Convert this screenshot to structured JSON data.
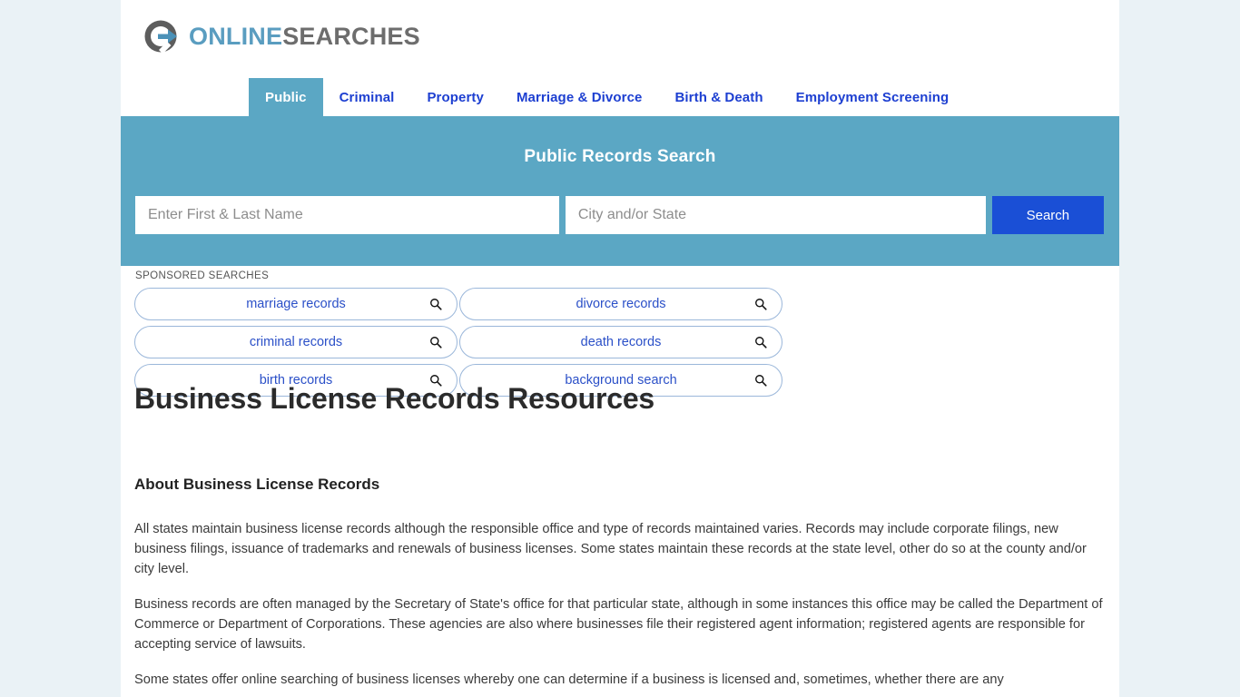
{
  "site": {
    "logo_primary": "ONLINE",
    "logo_secondary": "SEARCHES",
    "logo_icon": "circle-arrow-icon",
    "accent_teal": "#5ba7c4",
    "accent_blue": "#1a4fd6",
    "link_blue": "#2b50c8",
    "page_background": "#eaf2f6"
  },
  "nav": {
    "tabs": [
      {
        "label": "Public",
        "active": true
      },
      {
        "label": "Criminal",
        "active": false
      },
      {
        "label": "Property",
        "active": false
      },
      {
        "label": "Marriage & Divorce",
        "active": false
      },
      {
        "label": "Birth & Death",
        "active": false
      },
      {
        "label": "Employment Screening",
        "active": false
      }
    ]
  },
  "search_banner": {
    "title": "Public Records Search",
    "name_placeholder": "Enter First & Last Name",
    "name_value": "",
    "location_placeholder": "City and/or State",
    "location_value": "",
    "button_label": "Search"
  },
  "sponsored": {
    "label": "SPONSORED SEARCHES",
    "items": [
      {
        "label": "marriage records",
        "icon": "search-icon"
      },
      {
        "label": "divorce records",
        "icon": "search-icon"
      },
      {
        "label": "criminal records",
        "icon": "search-icon"
      },
      {
        "label": "death records",
        "icon": "search-icon"
      },
      {
        "label": "birth records",
        "icon": "search-icon"
      },
      {
        "label": "background search",
        "icon": "search-icon"
      }
    ]
  },
  "article": {
    "title": "Business License Records Resources",
    "section_heading": "About Business License Records",
    "paragraphs": [
      "All states maintain business license records although the responsible office and type of records maintained varies. Records may include corporate filings, new business filings, issuance of trademarks and renewals of business licenses. Some states maintain these records at the state level, other do so at the county and/or city level.",
      "Business records are often managed by the Secretary of State's office for that particular state, although in some instances this office may be called the Department of Commerce or Department of Corporations. These agencies are also where businesses file their registered agent information; registered agents are responsible for accepting service of lawsuits.",
      "Some states offer online searching of business licenses whereby one can determine if a business is licensed and, sometimes, whether there are any"
    ]
  }
}
